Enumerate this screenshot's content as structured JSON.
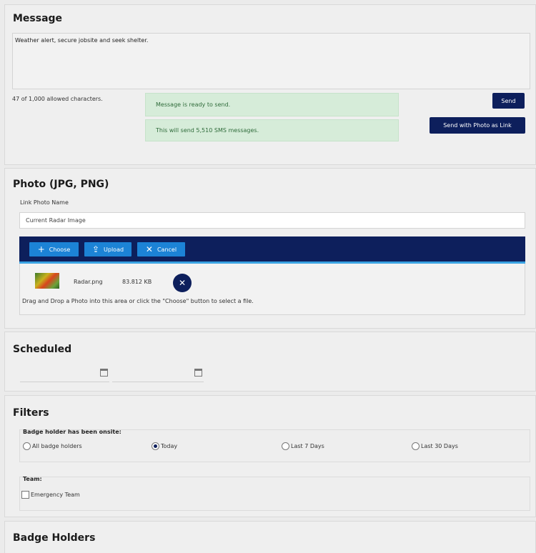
{
  "message": {
    "title": "Message",
    "text": "Weather alert, secure jobsite and seek shelter.",
    "char_count": "47 of 1,000 allowed characters.",
    "status_ready": "Message is ready to send.",
    "status_count": "This will send 5,510 SMS messages.",
    "send_label": "Send",
    "send_photo_label": "Send with Photo as Link"
  },
  "photo": {
    "title": "Photo (JPG, PNG)",
    "link_name_label": "Link Photo Name",
    "link_name_value": "Current Radar Image",
    "choose_label": "Choose",
    "upload_label": "Upload",
    "cancel_label": "Cancel",
    "file_name": "Radar.png",
    "file_size": "83.812 KB",
    "hint": "Drag and Drop a Photo into this area or click the \"Choose\" button to select a file.",
    "icons": [
      "plus-icon",
      "upload-icon",
      "close-icon",
      "image-thumbnail",
      "close-icon"
    ]
  },
  "scheduled": {
    "title": "Scheduled",
    "icons": [
      "calendar-icon",
      "calendar-icon"
    ]
  },
  "filters": {
    "title": "Filters",
    "onsite_legend": "Badge holder has been onsite:",
    "options": [
      "All badge holders",
      "Today",
      "Last 7 Days",
      "Last 30 Days"
    ],
    "selected": "Today",
    "team_legend": "Team:",
    "team_option": "Emergency Team"
  },
  "badge_holders": {
    "title": "Badge Holders"
  },
  "colors": {
    "navy": "#0d1f5c",
    "button_blue": "#1c83d6",
    "success_bg": "#d6ecd9",
    "success_text": "#2f6b3a"
  }
}
